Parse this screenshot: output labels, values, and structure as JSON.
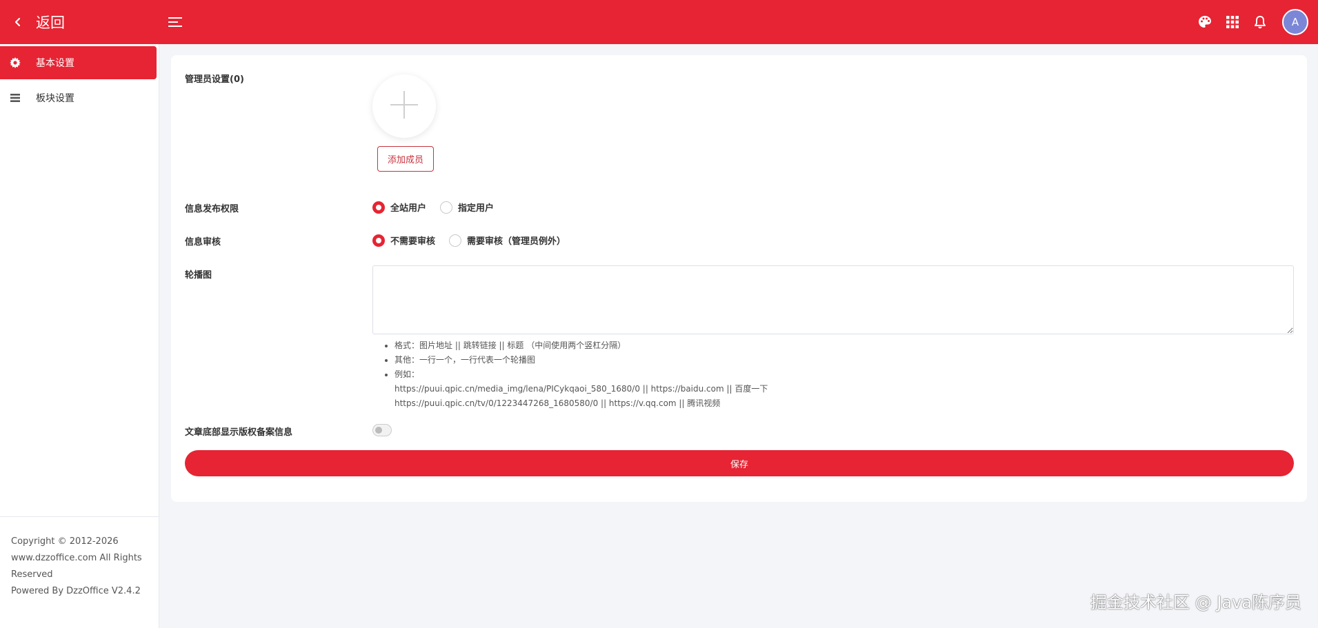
{
  "header": {
    "back_label": "返回",
    "avatar_letter": "A",
    "color": "#e62433"
  },
  "sidebar": {
    "items": [
      {
        "label": "基本设置",
        "icon": "gear-icon",
        "active": true
      },
      {
        "label": "板块设置",
        "icon": "list-icon",
        "active": false
      }
    ],
    "footer": [
      "Copyright © 2012-2026",
      "www.dzzoffice.com All Rights",
      "Reserved",
      "Powered By DzzOffice V2.4.2"
    ]
  },
  "form": {
    "admin_label": "管理员设置(0)",
    "add_member_label": "添加成员",
    "publish_label": "信息发布权限",
    "publish_options": [
      "全站用户",
      "指定用户"
    ],
    "publish_selected": 0,
    "review_label": "信息审核",
    "review_options": [
      "不需要审核",
      "需要审核（管理员例外）"
    ],
    "review_selected": 0,
    "carousel_label": "轮播图",
    "carousel_value": "",
    "hints": {
      "format": "格式：图片地址 || 跳转链接 || 标题 （中间使用两个竖杠分隔）",
      "other": "其他：一行一个，一行代表一个轮播图",
      "example": "例如：",
      "example1": "https://puui.qpic.cn/media_img/lena/PICykqaoi_580_1680/0 || https://baidu.com || 百度一下",
      "example2": "https://puui.qpic.cn/tv/0/1223447268_1680580/0 || https://v.qq.com || 腾讯视频"
    },
    "copyright_toggle_label": "文章底部显示版权备案信息",
    "copyright_toggle_on": false,
    "save_label": "保存"
  },
  "watermark": "掘金技术社区 @ Java陈序员"
}
